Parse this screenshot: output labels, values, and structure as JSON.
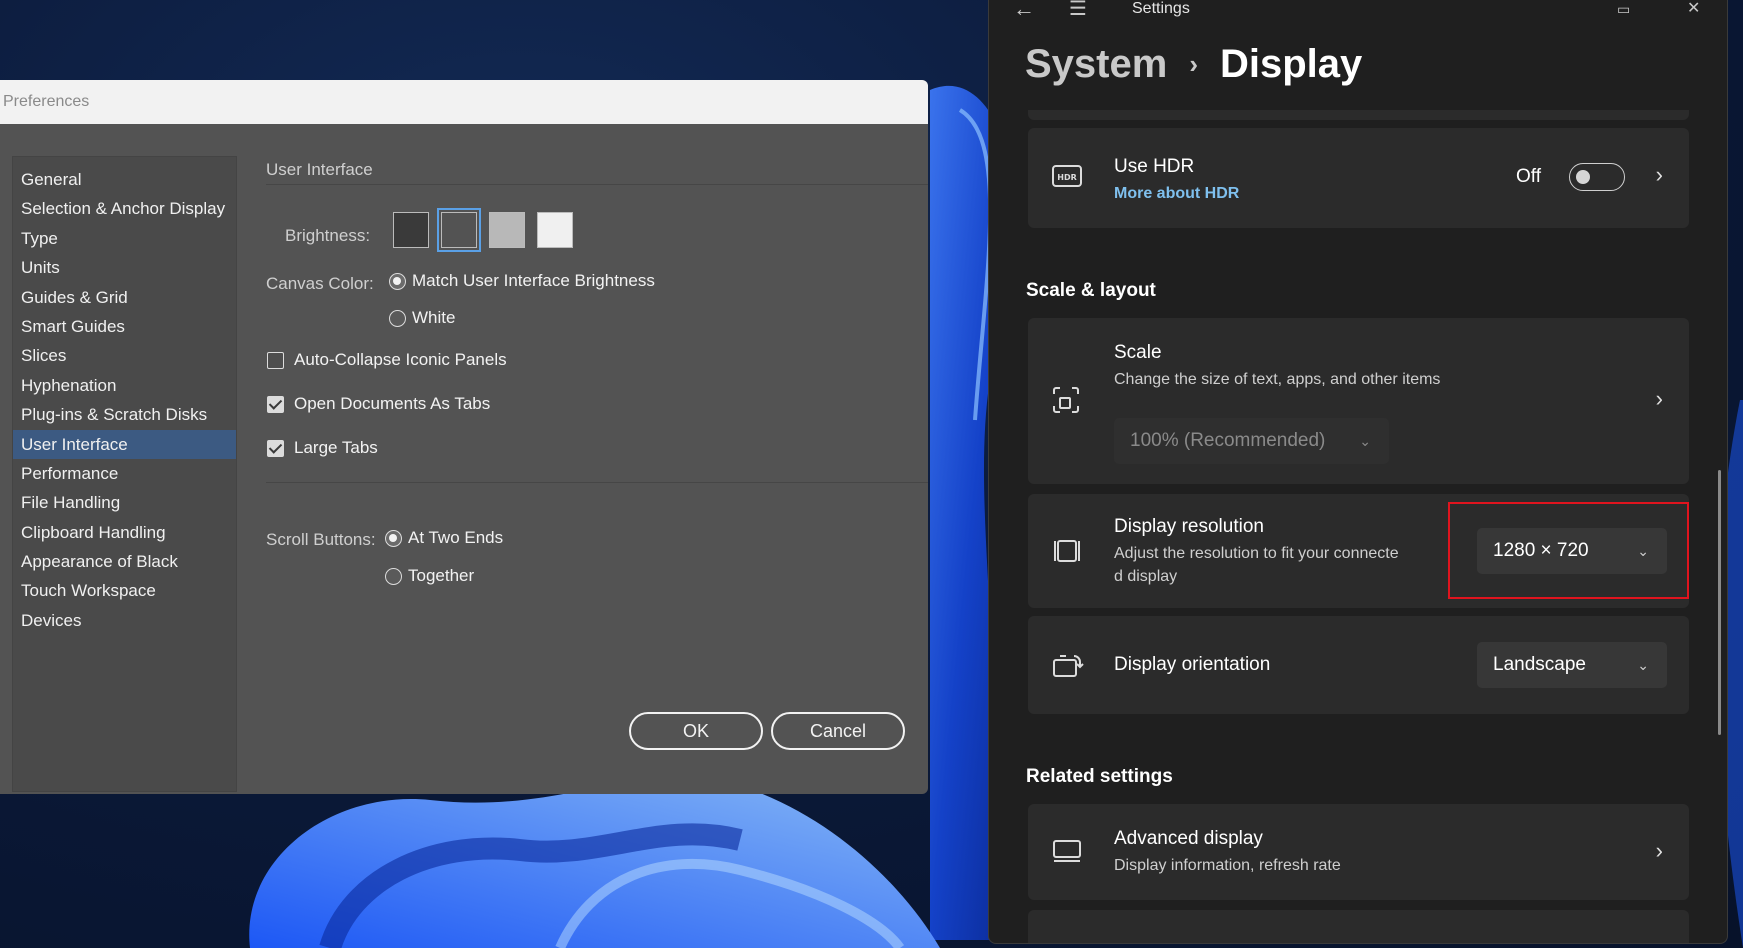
{
  "preferences": {
    "title": "Preferences",
    "nav": [
      {
        "label": "General"
      },
      {
        "label": "Selection & Anchor Display"
      },
      {
        "label": "Type"
      },
      {
        "label": "Units"
      },
      {
        "label": "Guides & Grid"
      },
      {
        "label": "Smart Guides"
      },
      {
        "label": "Slices"
      },
      {
        "label": "Hyphenation"
      },
      {
        "label": "Plug-ins & Scratch Disks"
      },
      {
        "label": "User Interface",
        "selected": true
      },
      {
        "label": "Performance"
      },
      {
        "label": "File Handling"
      },
      {
        "label": "Clipboard Handling"
      },
      {
        "label": "Appearance of Black"
      },
      {
        "label": "Touch Workspace"
      },
      {
        "label": "Devices"
      }
    ],
    "section_title": "User Interface",
    "brightness_label": "Brightness:",
    "brightness_swatches": [
      "#3a3a3a",
      "#535353",
      "#b8b8b8",
      "#f0f0f0"
    ],
    "brightness_selected": 1,
    "canvas_color_label": "Canvas Color:",
    "canvas_options": [
      "Match User Interface Brightness",
      "White"
    ],
    "canvas_selected": 0,
    "checkboxes": [
      {
        "label": "Auto-Collapse Iconic Panels",
        "checked": false
      },
      {
        "label": "Open Documents As Tabs",
        "checked": true
      },
      {
        "label": "Large Tabs",
        "checked": true
      }
    ],
    "scroll_buttons_label": "Scroll Buttons:",
    "scroll_options": [
      "At Two Ends",
      "Together"
    ],
    "scroll_selected": 0,
    "ok_label": "OK",
    "cancel_label": "Cancel"
  },
  "settings": {
    "window_title": "Settings",
    "breadcrumb_parent": "System",
    "breadcrumb_separator": "›",
    "breadcrumb_current": "Display",
    "hdr": {
      "title": "Use HDR",
      "link": "More about HDR",
      "state_label": "Off",
      "icon": "hdr-icon"
    },
    "scale_layout_title": "Scale & layout",
    "scale": {
      "title": "Scale",
      "subtitle": "Change the size of text, apps, and other items",
      "value": "100% (Recommended)",
      "icon": "scale-icon"
    },
    "resolution": {
      "title": "Display resolution",
      "subtitle_line1": "Adjust the resolution to fit your connecte",
      "subtitle_line2": "d display",
      "value": "1280 × 720",
      "icon": "resolution-icon"
    },
    "orientation": {
      "title": "Display orientation",
      "value": "Landscape",
      "icon": "orientation-icon"
    },
    "related_title": "Related settings",
    "advanced": {
      "title": "Advanced display",
      "subtitle": "Display information, refresh rate",
      "icon": "monitor-icon"
    },
    "highlight_color": "#e0141e"
  }
}
